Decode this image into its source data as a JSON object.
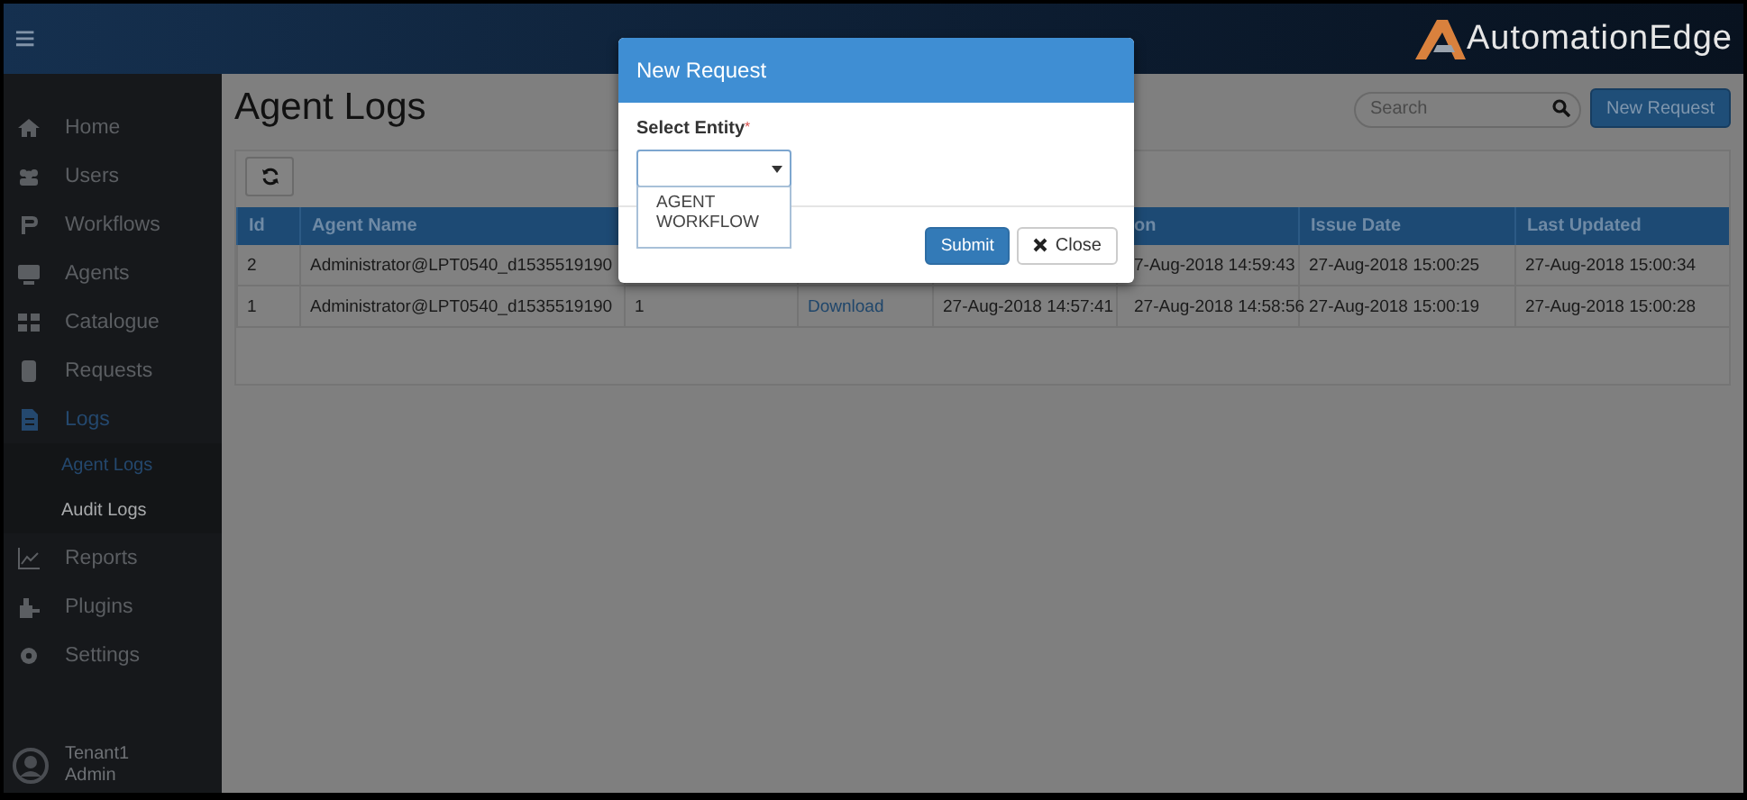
{
  "top_bar": {
    "menu_icon": "≡",
    "logo_text": "AutomationEdge"
  },
  "sidebar": {
    "items": [
      {
        "label": "Home",
        "selected": false
      },
      {
        "label": "Users",
        "selected": false
      },
      {
        "label": "Workflows",
        "selected": false
      },
      {
        "label": "Agents",
        "selected": false
      },
      {
        "label": "Catalogue",
        "selected": false
      },
      {
        "label": "Requests",
        "selected": false
      },
      {
        "label": "Logs",
        "selected": true,
        "children": [
          {
            "label": "Agent Logs",
            "selected": true
          },
          {
            "label": "Audit Logs",
            "selected": false
          }
        ]
      },
      {
        "label": "Reports",
        "selected": false
      },
      {
        "label": "Plugins",
        "selected": false
      },
      {
        "label": "Settings",
        "selected": false
      }
    ],
    "user": {
      "tenant": "Tenant1",
      "role": "Admin"
    }
  },
  "page": {
    "title": "Agent Logs",
    "search": {
      "placeholder": "Search"
    },
    "new_request_button": "New Request"
  },
  "table": {
    "columns": [
      {
        "label": "Id"
      },
      {
        "label": "Agent Name"
      },
      {},
      {},
      {},
      {
        "label": "on"
      },
      {
        "label": "Issue Date"
      },
      {
        "label": "Last Updated"
      }
    ],
    "rows": [
      {
        "cells": [
          {
            "text": "2"
          },
          {
            "text": "Administrator@LPT0540_d1535519190"
          },
          {},
          {},
          {},
          {
            "text": "7-Aug-2018 14:59:43"
          },
          {
            "text": "27-Aug-2018 15:00:25"
          },
          {
            "text": "27-Aug-2018 15:00:34"
          }
        ]
      },
      {
        "cells": [
          {
            "text": "1"
          },
          {
            "text": "Administrator@LPT0540_d1535519190"
          },
          {
            "text": "1"
          },
          {
            "text": "Download",
            "kind": "link"
          },
          {
            "text": "27-Aug-2018 14:57:41"
          },
          {
            "text": "27-Aug-2018 14:58:56"
          },
          {
            "text": "27-Aug-2018 15:00:19"
          },
          {
            "text": "27-Aug-2018 15:00:28"
          }
        ]
      }
    ]
  },
  "modal": {
    "title": "New Request",
    "field_label": "Select Entity",
    "required_mark": "*",
    "dropdown_open": true,
    "options": [
      "AGENT WORKFLOW"
    ],
    "submit_button": "Submit",
    "close_button": "Close"
  }
}
